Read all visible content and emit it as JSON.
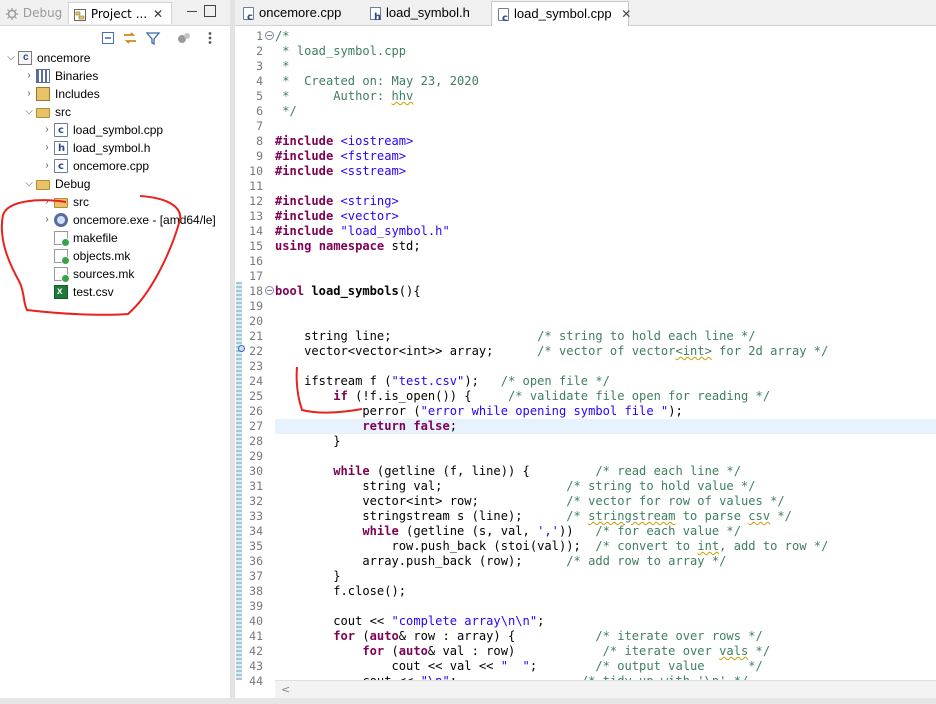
{
  "left_panel": {
    "tabs": {
      "debug": "Debug",
      "project": "Project ..."
    },
    "tree": [
      {
        "label": "oncemore",
        "icon": "project-icon",
        "twisty": "open"
      },
      {
        "label": "Binaries",
        "icon": "binaries-icon",
        "twisty": "closed"
      },
      {
        "label": "Includes",
        "icon": "includes-icon",
        "twisty": "closed"
      },
      {
        "label": "src",
        "icon": "folder-icon",
        "twisty": "open"
      },
      {
        "label": "load_symbol.cpp",
        "icon": "cpp-file-icon",
        "twisty": "closed"
      },
      {
        "label": "load_symbol.h",
        "icon": "header-file-icon",
        "twisty": "closed"
      },
      {
        "label": "oncemore.cpp",
        "icon": "cpp-file-icon",
        "twisty": "closed"
      },
      {
        "label": "Debug",
        "icon": "folder-icon",
        "twisty": "open"
      },
      {
        "label": "src",
        "icon": "folder-icon",
        "twisty": "closed"
      },
      {
        "label": "oncemore.exe - [amd64/le]",
        "icon": "executable-icon",
        "twisty": "closed"
      },
      {
        "label": "makefile",
        "icon": "makefile-icon",
        "twisty": "none"
      },
      {
        "label": "objects.mk",
        "icon": "makefile-icon",
        "twisty": "none"
      },
      {
        "label": "sources.mk",
        "icon": "makefile-icon",
        "twisty": "none"
      },
      {
        "label": "test.csv",
        "icon": "csv-file-icon",
        "twisty": "none"
      }
    ]
  },
  "editor": {
    "tabs": {
      "tab1": "oncemore.cpp",
      "tab2": "load_symbol.h",
      "tab3": "load_symbol.cpp"
    },
    "current_line": 27,
    "lines": {
      "1": "/*",
      "2": " * load_symbol.cpp",
      "3": " *",
      "4a": " *  Created on: May 23, 2020",
      "5a": " *      Author: ",
      "5b": "hhv",
      "6": " */",
      "7": "",
      "8a": "#include",
      "8b": " <iostream>",
      "9a": "#include",
      "9b": " <fstream>",
      "10a": "#include",
      "10b": " <sstream>",
      "11": "",
      "12a": "#include",
      "12b": " <string>",
      "13a": "#include",
      "13b": " <vector>",
      "14a": "#include",
      "14b": " \"load_symbol.h\"",
      "15a": "using",
      "15b": " ",
      "15c": "namespace",
      "15d": " std;",
      "16": "",
      "17": "",
      "18a": "bool",
      "18b": " ",
      "18c": "load_symbols",
      "18d": "(){",
      "19": "",
      "20": "",
      "21a": "    string line;                    ",
      "21b": "/* string to hold each line */",
      "22a": "    vector<vector<int>> array;      ",
      "22b": "/* vector of vector",
      "22c": "<int>",
      "22d": " for 2d array */",
      "23": "",
      "24a": "    ifstream f (",
      "24b": "\"test.csv\"",
      "24c": ");   ",
      "24d": "/* open file */",
      "25a": "        ",
      "25b": "if",
      "25c": " (!f.is_open()) {     ",
      "25d": "/* validate file open for reading */",
      "26a": "            perror (",
      "26b": "\"error while opening symbol file \"",
      "26c": ");",
      "27a": "            ",
      "27b": "return",
      "27c": " ",
      "27d": "false",
      "27e": ";",
      "28": "        }",
      "29": "",
      "30a": "        ",
      "30b": "while",
      "30c": " (getline (f, line)) {         ",
      "30d": "/* read each line */",
      "31a": "            string val;                 ",
      "31b": "/* string to hold value */",
      "32a": "            vector<int> row;            ",
      "32b": "/* vector for row of values */",
      "33a": "            stringstream s (line);      ",
      "33b": "/* ",
      "33c": "stringstream",
      "33d": " to parse ",
      "33e": "csv",
      "33f": " */",
      "34a": "            ",
      "34b": "while",
      "34c": " (getline (s, val, ",
      "34d": "','",
      "34e": "))   ",
      "34f": "/* for each value */",
      "35a": "                row.push_back (stoi(val));  ",
      "35b": "/* convert to ",
      "35c": "int",
      "35d": ", add to row */",
      "36a": "            array.push_back (row);      ",
      "36b": "/* add row to array */",
      "37": "        }",
      "38": "        f.close();",
      "39": "",
      "40a": "        cout << ",
      "40b": "\"complete array\\n\\n\"",
      "40c": ";",
      "41a": "        ",
      "41b": "for",
      "41c": " (",
      "41d": "auto",
      "41e": "& row : array) {           ",
      "41f": "/* iterate over rows */",
      "42a": "            ",
      "42b": "for",
      "42c": " (",
      "42d": "auto",
      "42e": "& val : row)            ",
      "42f": "/* iterate over ",
      "42g": "vals",
      "42h": " */",
      "43a": "                cout << val << ",
      "43b": "\"  \"",
      "43c": ";        ",
      "43d": "/* output value      */",
      "44a": "            cout << ",
      "44b": "\"\\n\"",
      "44c": ";                 ",
      "44d": "/* tidy up with '\\n' */"
    }
  }
}
